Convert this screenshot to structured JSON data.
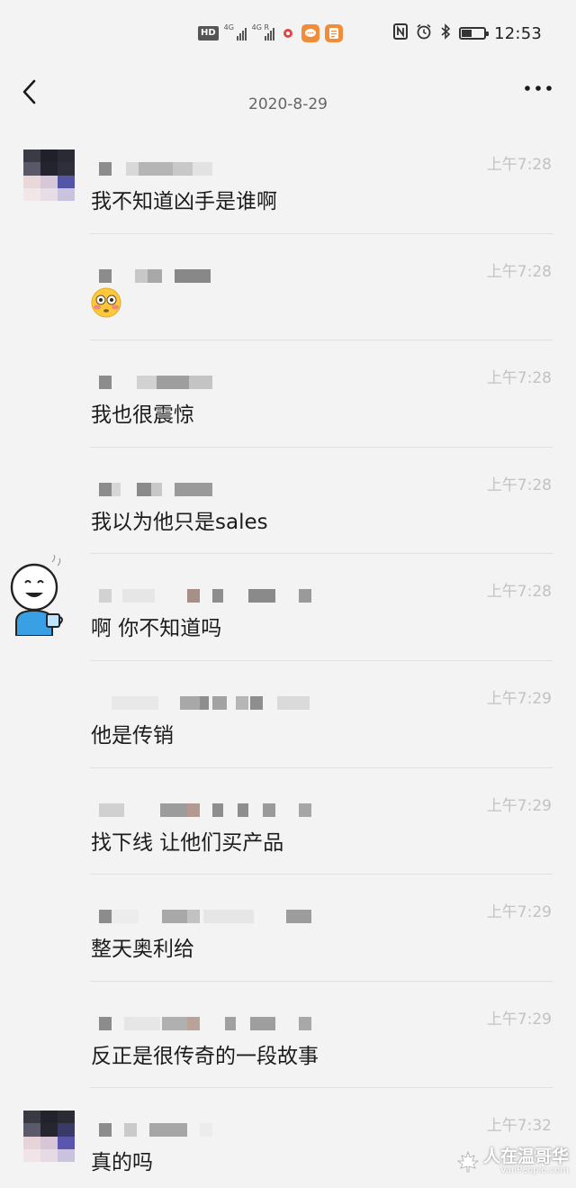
{
  "status_bar": {
    "network_labels": [
      "4G",
      "4G R"
    ],
    "hd_label": "HD",
    "time": "12:53",
    "icons": [
      "hd-voice-icon",
      "signal-4g-icon",
      "signal-4g-roaming-icon",
      "app-notification-icon",
      "message-app-icon",
      "note-app-icon",
      "nfc-icon",
      "alarm-icon",
      "bluetooth-icon",
      "battery-icon"
    ]
  },
  "nav": {
    "title": "2020-8-29",
    "back_icon": "chevron-left-icon",
    "more_icon": "more-dots-icon"
  },
  "messages": [
    {
      "time": "上午7:28",
      "text": "我不知道凶手是谁啊",
      "avatar": "pixelated-photo"
    },
    {
      "time": "上午7:28",
      "text": "",
      "emoji": "flushed-face-emoji"
    },
    {
      "time": "上午7:28",
      "text": "我也很震惊"
    },
    {
      "time": "上午7:28",
      "text": "我以为他只是sales"
    },
    {
      "time": "上午7:28",
      "text": "啊 你不知道吗",
      "avatar": "cartoon-coffee"
    },
    {
      "time": "上午7:29",
      "text": "他是传销"
    },
    {
      "time": "上午7:29",
      "text": "找下线 让他们买产品"
    },
    {
      "time": "上午7:29",
      "text": "整天奥利给"
    },
    {
      "time": "上午7:29",
      "text": "反正是很传奇的一段故事"
    },
    {
      "time": "上午7:32",
      "text": "真的吗",
      "avatar": "pixelated-photo"
    }
  ],
  "watermark": {
    "main": "人在温哥华",
    "sub": "VanPeople.com"
  },
  "colors": {
    "background": "#f3f3f3",
    "time_text": "#c2c2c2",
    "divider": "#e1e1e1",
    "message_text": "#1c1c1c"
  }
}
